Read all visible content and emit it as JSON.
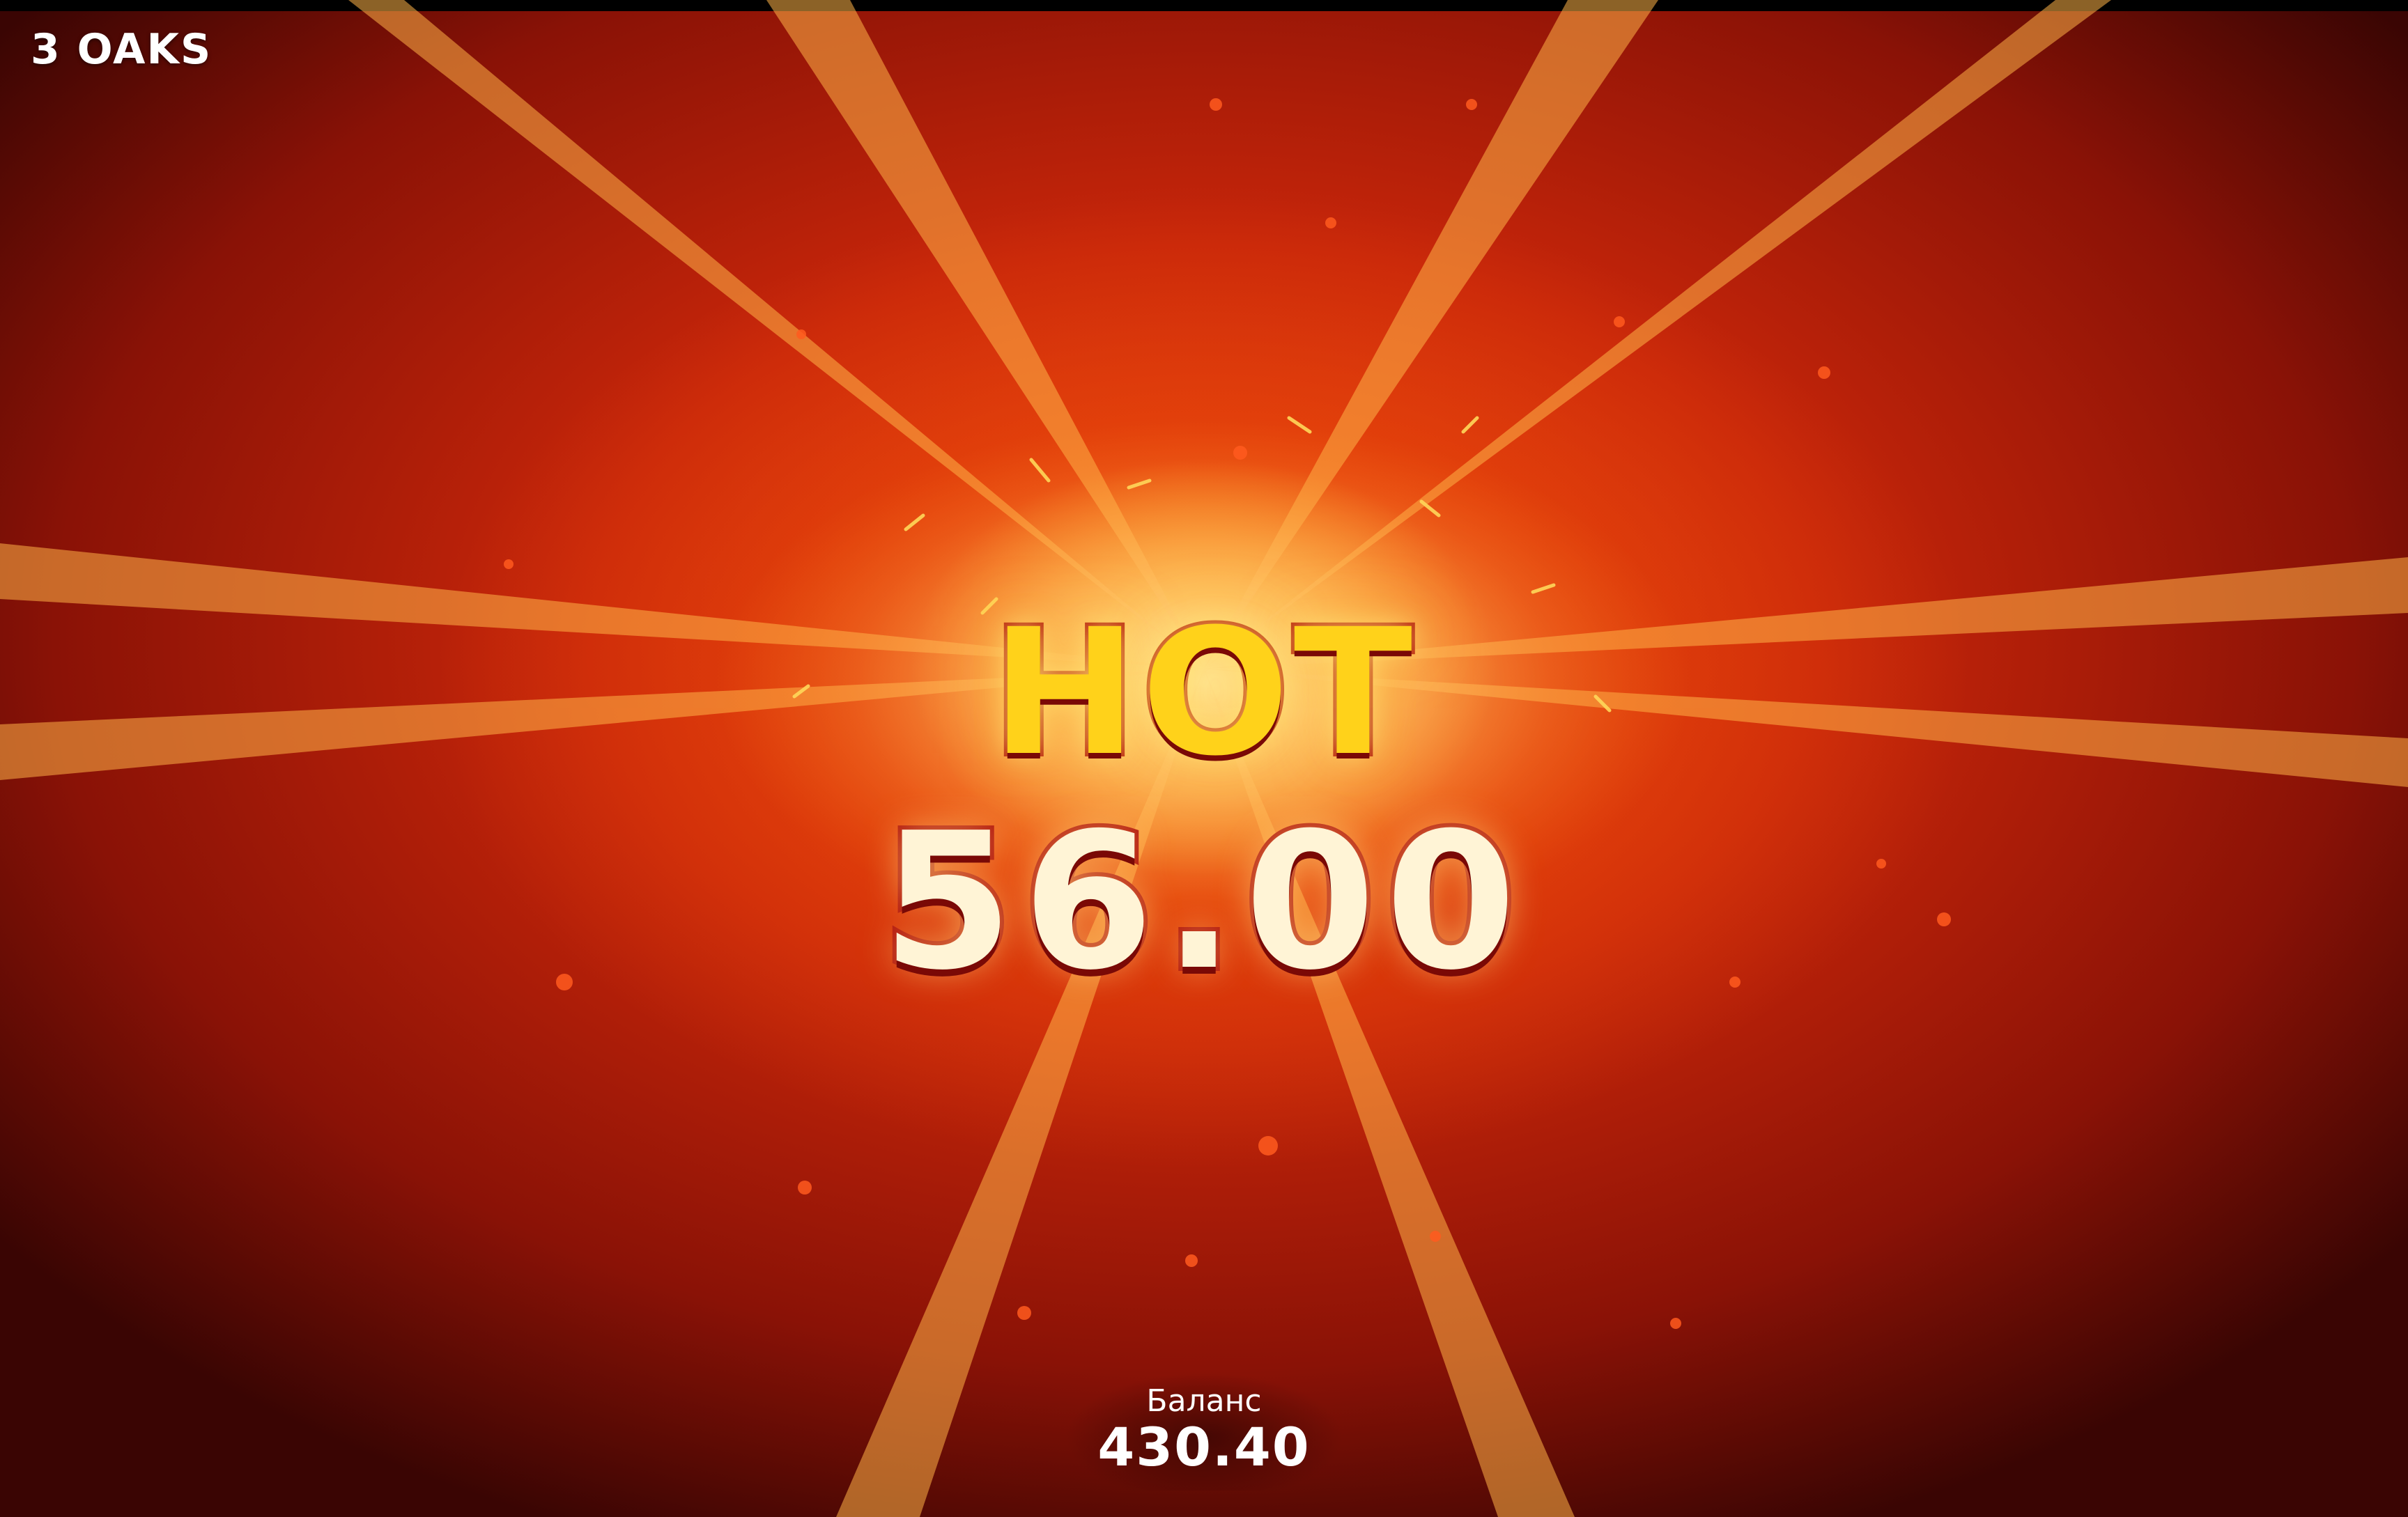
{
  "brand": {
    "name": "3 OAKS"
  },
  "win": {
    "title": "HOT",
    "amount": "56.00"
  },
  "balance": {
    "label": "Баланс",
    "value": "430.40"
  },
  "colors": {
    "background_core": "#ffd23a",
    "background_mid": "#e8400e",
    "background_edge": "#3a0503",
    "title_fill": "#ffd21a",
    "amount_fill": "#fff4d6",
    "text_outline": "#b1120a"
  }
}
